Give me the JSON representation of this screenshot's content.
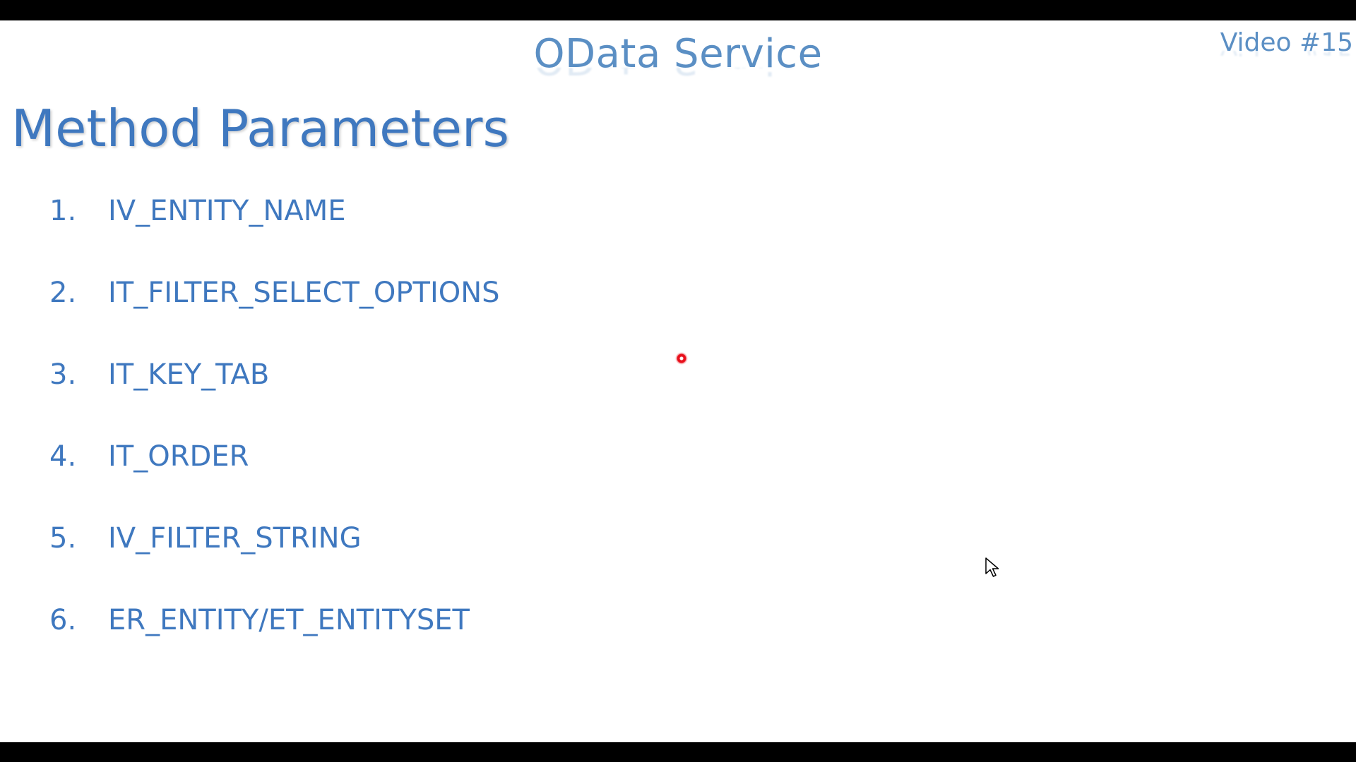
{
  "slide": {
    "header_title": "OData Service",
    "video_tag": "Video #15",
    "main_title": "Method Parameters",
    "parameters": [
      {
        "number": "1.",
        "name": "IV_ENTITY_NAME"
      },
      {
        "number": "2.",
        "name": "IT_FILTER_SELECT_OPTIONS"
      },
      {
        "number": "3.",
        "name": "IT_KEY_TAB"
      },
      {
        "number": "4.",
        "name": "IT_ORDER"
      },
      {
        "number": "5.",
        "name": "IV_FILTER_STRING"
      },
      {
        "number": "6.",
        "name": "ER_ENTITY/ET_ENTITYSET"
      }
    ]
  },
  "icons": {
    "laser": "laser-pointer-icon",
    "cursor": "mouse-cursor-icon"
  },
  "colors": {
    "header": "#5b8fc4",
    "title": "#3f78bf",
    "list": "#3f78bf",
    "laser": "#e8101b",
    "letterbox": "#000000",
    "slide_background": "#ffffff"
  }
}
